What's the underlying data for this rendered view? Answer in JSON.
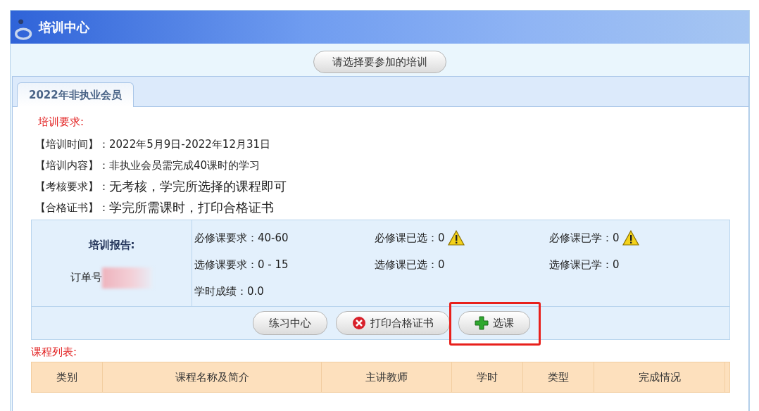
{
  "header": {
    "title": "培训中心"
  },
  "select_training_button": "请选择要参加的培训",
  "tabs": [
    {
      "label": "2022年非执业会员",
      "selected": true
    }
  ],
  "requirements": {
    "heading": "培训要求:",
    "items": [
      {
        "label": "【培训时间】：",
        "value": "2022年5月9日-2022年12月31日",
        "large": false
      },
      {
        "label": "【培训内容】：",
        "value": "非执业会员需完成40课时的学习",
        "large": false
      },
      {
        "label": "【考核要求】：",
        "value": "无考核，学完所选择的课程即可",
        "large": true
      },
      {
        "label": "【合格证书】：",
        "value": "学完所需课时，打印合格证书",
        "large": true
      }
    ]
  },
  "report": {
    "title": "培训报告:",
    "order_label": "订单号",
    "order_redacted": true,
    "stats": [
      [
        {
          "text": "必修课要求：40-60",
          "warning": false
        },
        {
          "text": "必修课已选：0",
          "warning": true
        },
        {
          "text": "必修课已学：0",
          "warning": true
        }
      ],
      [
        {
          "text": "选修课要求：0 - 15",
          "warning": false
        },
        {
          "text": "选修课已选：0",
          "warning": false
        },
        {
          "text": "选修课已学：0",
          "warning": false
        }
      ],
      [
        {
          "text": "学时成绩：0.0",
          "warning": false
        }
      ]
    ]
  },
  "actions": [
    {
      "label": "练习中心",
      "kind": "plain",
      "highlighted": false
    },
    {
      "label": "打印合格证书",
      "kind": "cross",
      "highlighted": false
    },
    {
      "label": "选课",
      "kind": "plus",
      "highlighted": true
    }
  ],
  "course_list": {
    "heading": "课程列表:",
    "columns": [
      "类别",
      "课程名称及简介",
      "主讲教师",
      "学时",
      "类型",
      "完成情况"
    ]
  }
}
